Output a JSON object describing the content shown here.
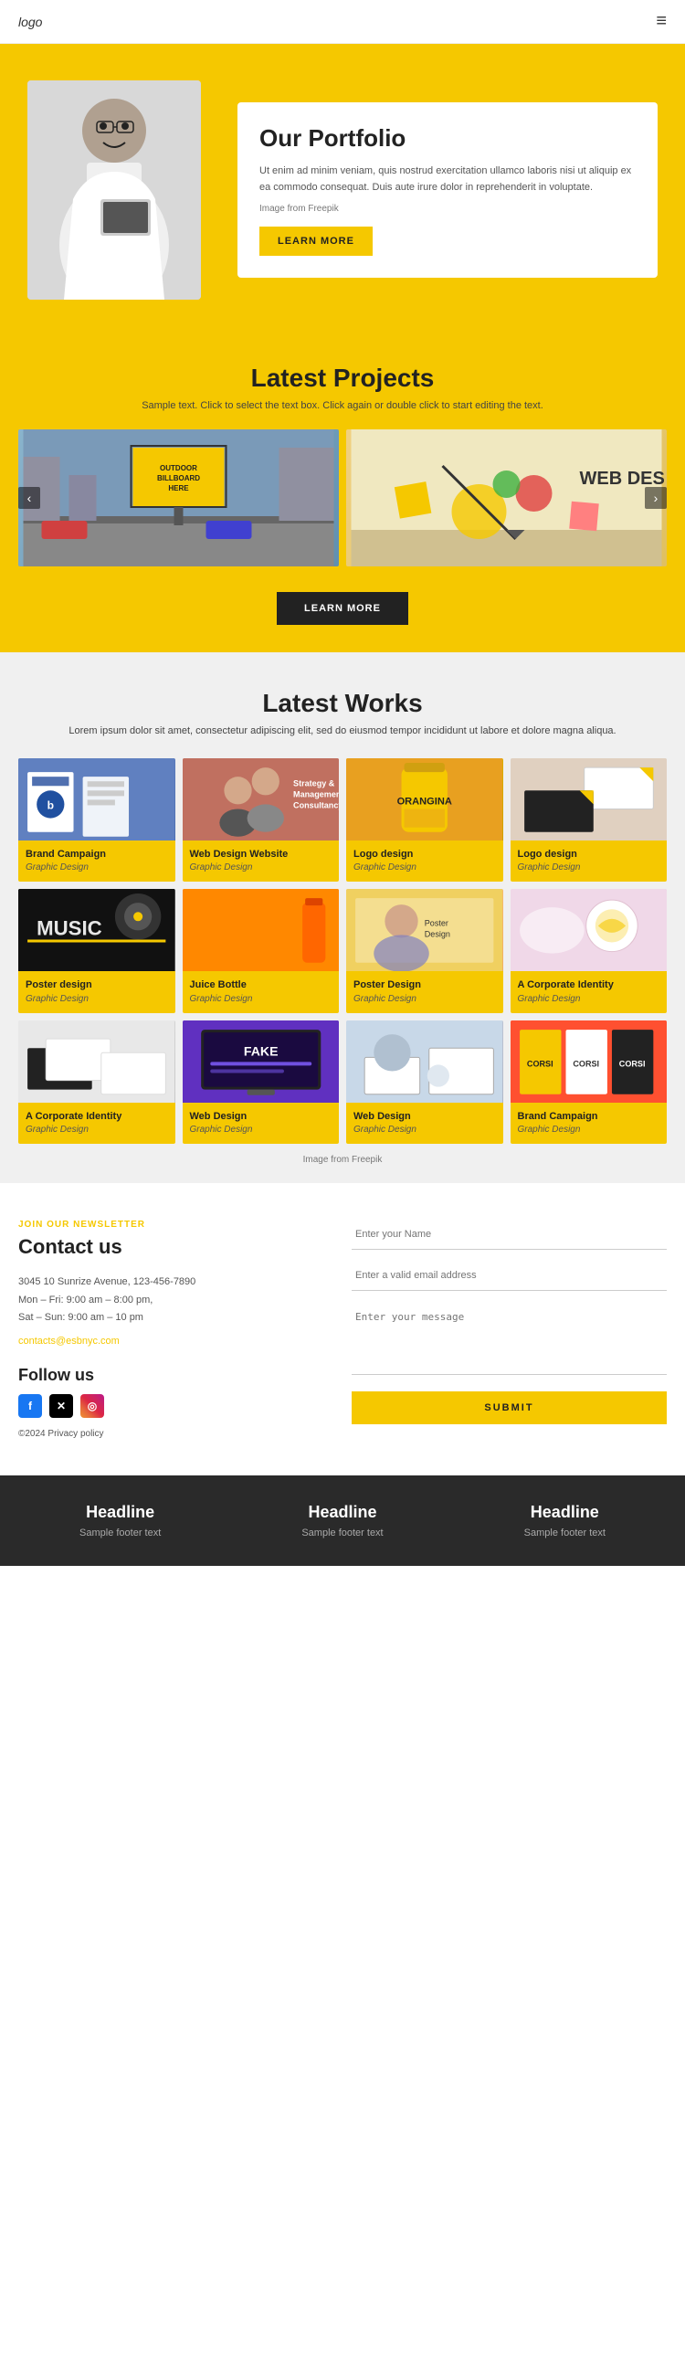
{
  "header": {
    "logo": "logo",
    "menu_icon": "≡"
  },
  "hero": {
    "title": "Our Portfolio",
    "description": "Ut enim ad minim veniam, quis nostrud exercitation ullamco laboris nisi ut aliquip ex ea commodo consequat. Duis aute irure dolor in reprehenderit in voluptate.",
    "image_credit": "Image from Freepik",
    "cta_button": "LEARN MORE"
  },
  "projects": {
    "title": "Latest Projects",
    "subtitle": "Sample text. Click to select the text box. Click again or double click to start editing the text.",
    "cta_button": "LEARN MORE"
  },
  "works": {
    "title": "Latest Works",
    "subtitle": "Lorem ipsum dolor sit amet, consectetur adipiscing elit, sed do eiusmod tempor incididunt ut labore et dolore magna aliqua.",
    "freepik_note": "Image from Freepik",
    "items": [
      {
        "title": "Brand Campaign",
        "category": "Graphic Design",
        "img_class": "img-brand1"
      },
      {
        "title": "Web Design Website",
        "category": "Graphic Design",
        "img_class": "img-webdessite"
      },
      {
        "title": "Logo design",
        "category": "Graphic Design",
        "img_class": "img-logo1"
      },
      {
        "title": "Logo design",
        "category": "Graphic Design",
        "img_class": "img-logo2"
      },
      {
        "title": "Poster design",
        "category": "Graphic Design",
        "img_class": "img-poster"
      },
      {
        "title": "Juice Bottle",
        "category": "Graphic Design",
        "img_class": "img-juice"
      },
      {
        "title": "Poster Design",
        "category": "Graphic Design",
        "img_class": "img-poster2"
      },
      {
        "title": "A Corporate Identity",
        "category": "Graphic Design",
        "img_class": "img-corpid"
      },
      {
        "title": "A Corporate Identity",
        "category": "Graphic Design",
        "img_class": "img-corpid2"
      },
      {
        "title": "Web Design",
        "category": "Graphic Design",
        "img_class": "img-webdes2"
      },
      {
        "title": "Web Design",
        "category": "Graphic Design",
        "img_class": "img-webdes3"
      },
      {
        "title": "Brand Campaign",
        "category": "Graphic Design",
        "img_class": "img-brand2"
      }
    ]
  },
  "contact": {
    "label": "JOIN OUR NEWSLETTER",
    "title": "Contact us",
    "address": "3045 10 Sunrize Avenue, 123-456-7890",
    "hours1": "Mon – Fri: 9:00 am – 8:00 pm,",
    "hours2": "Sat – Sun: 9:00 am – 10 pm",
    "email": "contacts@esbnyc.com",
    "follow_title": "Follow us",
    "copyright": "©2024 Privacy policy",
    "form": {
      "name_placeholder": "Enter your Name",
      "email_placeholder": "Enter a valid email address",
      "message_placeholder": "Enter your message",
      "submit_button": "SUBMIT"
    }
  },
  "footer": {
    "columns": [
      {
        "title": "Headline",
        "text": "Sample footer text"
      },
      {
        "title": "Headline",
        "text": "Sample footer text"
      },
      {
        "title": "Headline",
        "text": "Sample footer text"
      }
    ]
  }
}
